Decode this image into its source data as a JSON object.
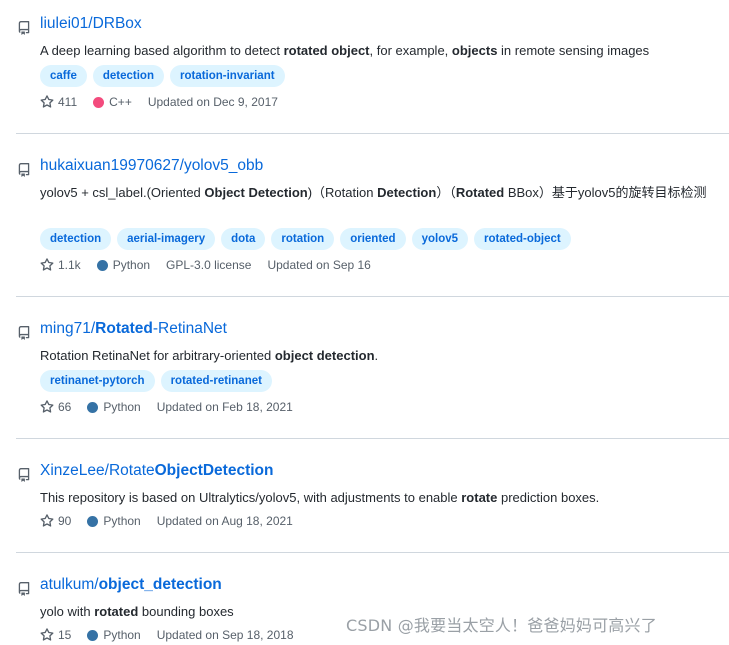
{
  "repos": [
    {
      "owner": "liulei01/",
      "name_parts": [
        {
          "t": "DRBox",
          "b": false
        }
      ],
      "description_parts": [
        {
          "t": "A deep learning based algorithm to detect ",
          "b": false
        },
        {
          "t": "rotated object",
          "b": true
        },
        {
          "t": ", for example, ",
          "b": false
        },
        {
          "t": "objects",
          "b": true
        },
        {
          "t": " in remote sensing images",
          "b": false
        }
      ],
      "topics": [
        "caffe",
        "detection",
        "rotation-invariant"
      ],
      "stars": "411",
      "language": "C++",
      "language_color": "#f34b7d",
      "license": "",
      "updated": "Updated on Dec 9, 2017"
    },
    {
      "owner": "hukaixuan19970627/",
      "name_parts": [
        {
          "t": "yolov5_obb",
          "b": false
        }
      ],
      "description_parts": [
        {
          "t": "yolov5 + csl_label.(Oriented ",
          "b": false
        },
        {
          "t": "Object Detection",
          "b": true
        },
        {
          "t": ")（Rotation ",
          "b": false
        },
        {
          "t": "Detection",
          "b": true
        },
        {
          "t": "）（",
          "b": false
        },
        {
          "t": "Rotated",
          "b": true
        },
        {
          "t": " BBox）基于yolov5的旋转目标检测",
          "b": false
        }
      ],
      "topics": [
        "detection",
        "aerial-imagery",
        "dota",
        "rotation",
        "oriented",
        "yolov5",
        "rotated-object"
      ],
      "stars": "1.1k",
      "language": "Python",
      "language_color": "#3572A5",
      "license": "GPL-3.0 license",
      "updated": "Updated on Sep 16"
    },
    {
      "owner": "ming71/",
      "name_parts": [
        {
          "t": "Rotated",
          "b": true
        },
        {
          "t": "-RetinaNet",
          "b": false
        }
      ],
      "description_parts": [
        {
          "t": "Rotation RetinaNet for arbitrary-oriented ",
          "b": false
        },
        {
          "t": "object detection",
          "b": true
        },
        {
          "t": ".",
          "b": false
        }
      ],
      "topics": [
        "retinanet-pytorch",
        "rotated-retinanet"
      ],
      "stars": "66",
      "language": "Python",
      "language_color": "#3572A5",
      "license": "",
      "updated": "Updated on Feb 18, 2021"
    },
    {
      "owner": "XinzeLee/",
      "name_parts": [
        {
          "t": "Rotate",
          "b": false
        },
        {
          "t": "ObjectDetection",
          "b": true
        }
      ],
      "description_parts": [
        {
          "t": "This repository is based on Ultralytics/yolov5, with adjustments to enable ",
          "b": false
        },
        {
          "t": "rotate",
          "b": true
        },
        {
          "t": " prediction boxes.",
          "b": false
        }
      ],
      "topics": [],
      "stars": "90",
      "language": "Python",
      "language_color": "#3572A5",
      "license": "",
      "updated": "Updated on Aug 18, 2021"
    },
    {
      "owner": "atulkum/",
      "name_parts": [
        {
          "t": "object_detection",
          "b": true
        }
      ],
      "description_parts": [
        {
          "t": "yolo with ",
          "b": false
        },
        {
          "t": "rotated",
          "b": true
        },
        {
          "t": " bounding boxes",
          "b": false
        }
      ],
      "topics": [],
      "stars": "15",
      "language": "Python",
      "language_color": "#3572A5",
      "license": "",
      "updated": "Updated on Sep 18, 2018"
    }
  ],
  "watermark": "CSDN @我要当太空人！爸爸妈妈可高兴了"
}
